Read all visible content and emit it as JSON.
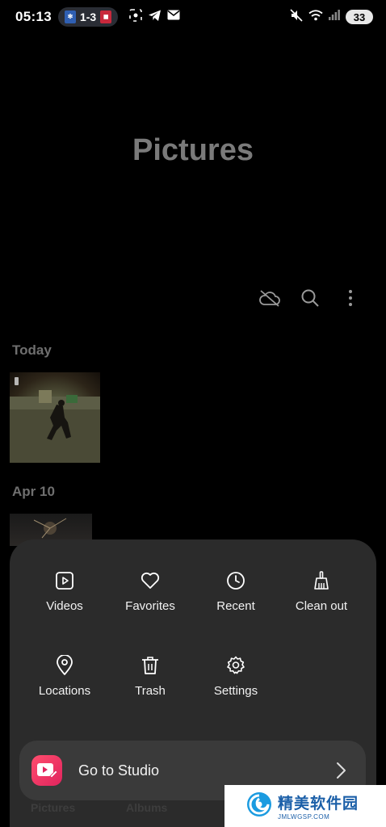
{
  "status_bar": {
    "time": "05:13",
    "score": "1-3",
    "battery": "33"
  },
  "page": {
    "title": "Pictures"
  },
  "toolbar": {
    "cloud_icon": "cloud-off-icon",
    "search_icon": "search-icon",
    "more_icon": "more-vertical-icon"
  },
  "sections": [
    {
      "label": "Today"
    },
    {
      "label": "Apr 10"
    }
  ],
  "menu": {
    "items": [
      {
        "label": "Videos",
        "icon": "video-icon"
      },
      {
        "label": "Favorites",
        "icon": "heart-icon"
      },
      {
        "label": "Recent",
        "icon": "clock-icon"
      },
      {
        "label": "Clean out",
        "icon": "broom-icon"
      },
      {
        "label": "Locations",
        "icon": "location-pin-icon"
      },
      {
        "label": "Trash",
        "icon": "trash-icon"
      },
      {
        "label": "Settings",
        "icon": "gear-icon"
      }
    ],
    "studio": {
      "label": "Go to Studio"
    }
  },
  "bottom_tabs": [
    "Pictures",
    "Albums"
  ],
  "watermark": {
    "cn": "精美软件园",
    "en": "JMLWGSP.COM"
  },
  "colors": {
    "background": "#000000",
    "panel": "#2b2b2b",
    "studio_bar": "#3a3a3a",
    "studio_accent": "#e0245e"
  }
}
